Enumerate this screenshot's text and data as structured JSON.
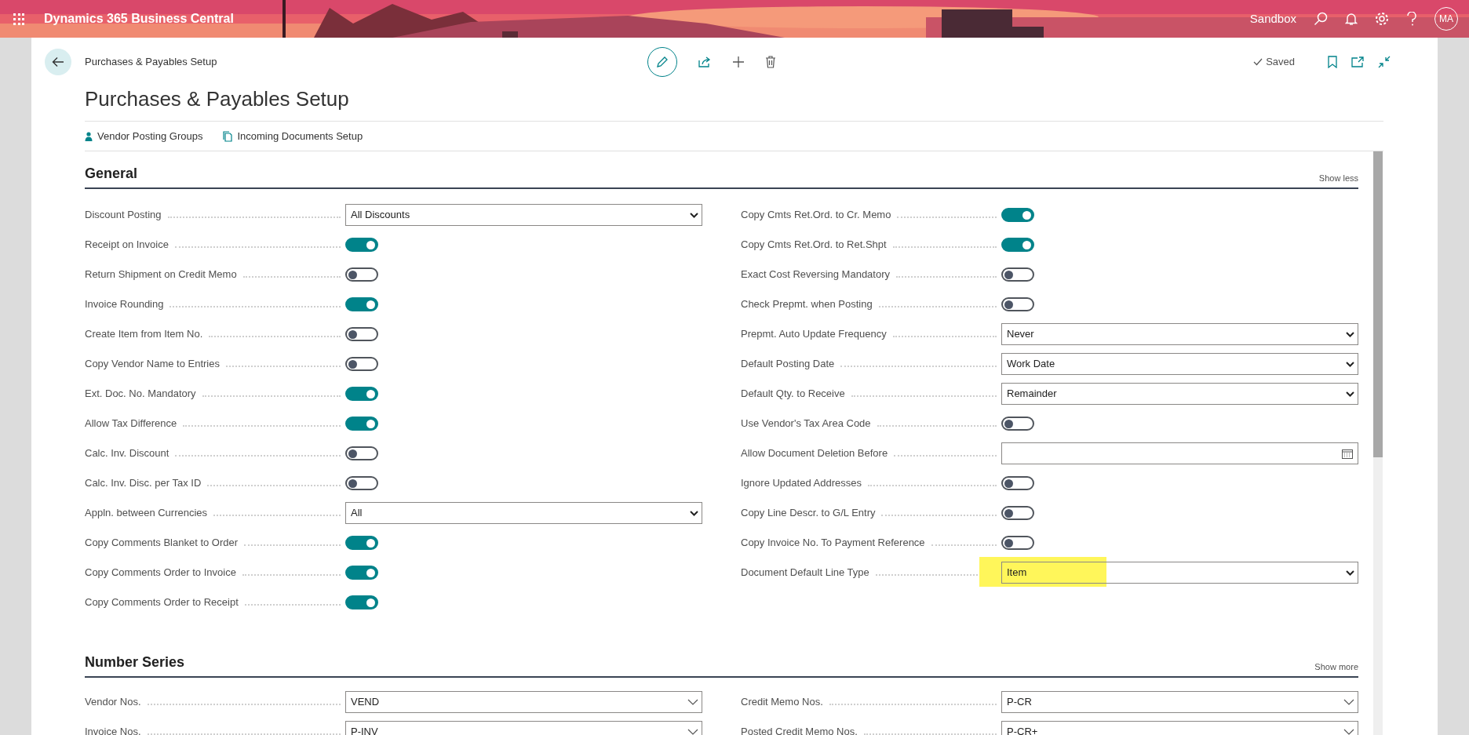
{
  "app_bar": {
    "title": "Dynamics 365 Business Central",
    "environment": "Sandbox",
    "avatar": "MA"
  },
  "breadcrumb": "Purchases & Payables Setup",
  "page_title": "Purchases & Payables Setup",
  "save_status": "Saved",
  "actions": [
    "Vendor Posting Groups",
    "Incoming Documents Setup"
  ],
  "sections": [
    {
      "title": "General",
      "toggle": "Show less",
      "columns": [
        [
          {
            "label": "Discount Posting",
            "kind": "select",
            "value": "All Discounts"
          },
          {
            "label": "Receipt on Invoice",
            "kind": "toggle",
            "on": true
          },
          {
            "label": "Return Shipment on Credit Memo",
            "kind": "toggle",
            "on": false
          },
          {
            "label": "Invoice Rounding",
            "kind": "toggle",
            "on": true
          },
          {
            "label": "Create Item from Item No.",
            "kind": "toggle",
            "on": false
          },
          {
            "label": "Copy Vendor Name to Entries",
            "kind": "toggle",
            "on": false
          },
          {
            "label": "Ext. Doc. No. Mandatory",
            "kind": "toggle",
            "on": true
          },
          {
            "label": "Allow Tax Difference",
            "kind": "toggle",
            "on": true
          },
          {
            "label": "Calc. Inv. Discount",
            "kind": "toggle",
            "on": false
          },
          {
            "label": "Calc. Inv. Disc. per Tax ID",
            "kind": "toggle",
            "on": false
          },
          {
            "label": "Appln. between Currencies",
            "kind": "select",
            "value": "All"
          },
          {
            "label": "Copy Comments Blanket to Order",
            "kind": "toggle",
            "on": true
          },
          {
            "label": "Copy Comments Order to Invoice",
            "kind": "toggle",
            "on": true
          },
          {
            "label": "Copy Comments Order to Receipt",
            "kind": "toggle",
            "on": true
          }
        ],
        [
          {
            "label": "Copy Cmts Ret.Ord. to Cr. Memo",
            "kind": "toggle",
            "on": true
          },
          {
            "label": "Copy Cmts Ret.Ord. to Ret.Shpt",
            "kind": "toggle",
            "on": true
          },
          {
            "label": "Exact Cost Reversing Mandatory",
            "kind": "toggle",
            "on": false
          },
          {
            "label": "Check Prepmt. when Posting",
            "kind": "toggle",
            "on": false
          },
          {
            "label": "Prepmt. Auto Update Frequency",
            "kind": "select",
            "value": "Never"
          },
          {
            "label": "Default Posting Date",
            "kind": "select",
            "value": "Work Date"
          },
          {
            "label": "Default Qty. to Receive",
            "kind": "select",
            "value": "Remainder"
          },
          {
            "label": "Use Vendor's Tax Area Code",
            "kind": "toggle",
            "on": false
          },
          {
            "label": "Allow Document Deletion Before",
            "kind": "date"
          },
          {
            "label": "Ignore Updated Addresses",
            "kind": "toggle",
            "on": false
          },
          {
            "label": "Copy Line Descr. to G/L Entry",
            "kind": "toggle",
            "on": false
          },
          {
            "label": "Copy Invoice No. To Payment Reference",
            "kind": "toggle",
            "on": false
          },
          {
            "label": "Document Default Line Type",
            "kind": "select",
            "value": "Item",
            "highlighted": true
          }
        ]
      ]
    },
    {
      "title": "Number Series",
      "toggle": "Show more",
      "columns": [
        [
          {
            "label": "Vendor Nos.",
            "kind": "lookup",
            "value": "VEND"
          },
          {
            "label": "Invoice Nos.",
            "kind": "lookup",
            "value": "P-INV"
          }
        ],
        [
          {
            "label": "Credit Memo Nos.",
            "kind": "lookup",
            "value": "P-CR"
          },
          {
            "label": "Posted Credit Memo Nos.",
            "kind": "lookup",
            "value": "P-CR+"
          }
        ]
      ]
    }
  ]
}
